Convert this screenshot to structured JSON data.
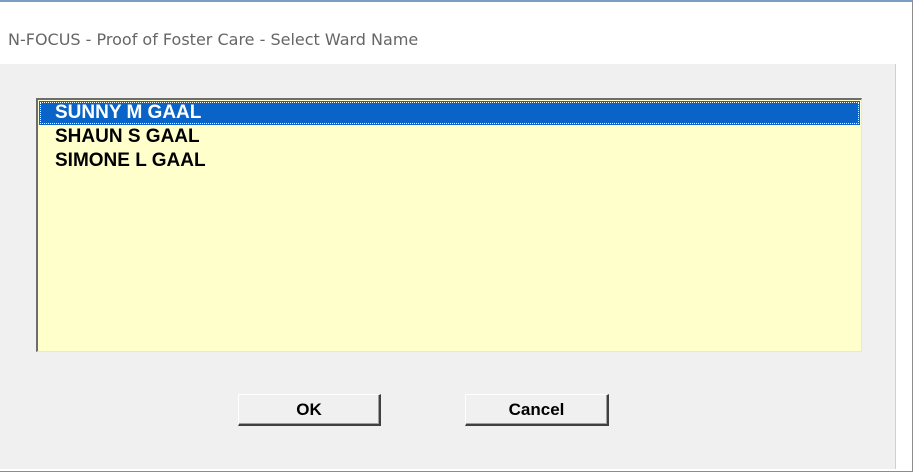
{
  "window": {
    "title": "N-FOCUS - Proof of Foster Care - Select Ward Name"
  },
  "ward_list": {
    "items": [
      {
        "label": "SUNNY M GAAL",
        "selected": true
      },
      {
        "label": "SHAUN S GAAL",
        "selected": false
      },
      {
        "label": "SIMONE L GAAL",
        "selected": false
      }
    ],
    "background_color": "#ffffcc",
    "selection_color": "#0a64c8"
  },
  "buttons": {
    "ok_label": "OK",
    "cancel_label": "Cancel"
  }
}
